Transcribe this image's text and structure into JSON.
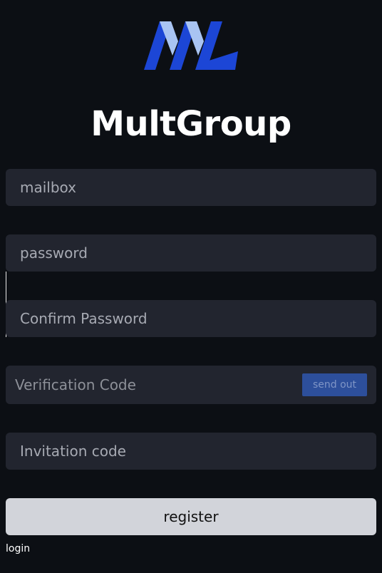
{
  "app": {
    "title": "MultGroup",
    "logo": "ml-logo",
    "brand_color": "#1c46d6",
    "brand_light_color": "#a9c4f2"
  },
  "form": {
    "mailbox": {
      "value": "",
      "placeholder": "mailbox"
    },
    "password": {
      "value": "",
      "placeholder": "password"
    },
    "confirm_password": {
      "value": "",
      "placeholder": "Confirm Password"
    },
    "verification_code": {
      "value": "",
      "placeholder": "Verification Code"
    },
    "send_label": "send out",
    "invitation_code": {
      "value": "",
      "placeholder": "Invitation code"
    },
    "register_label": "register",
    "login_label": "login"
  },
  "colors": {
    "background": "#0c0f14",
    "field_background": "#22252f",
    "send_button": "#2d4f9b",
    "register_button": "#d2d4da"
  }
}
